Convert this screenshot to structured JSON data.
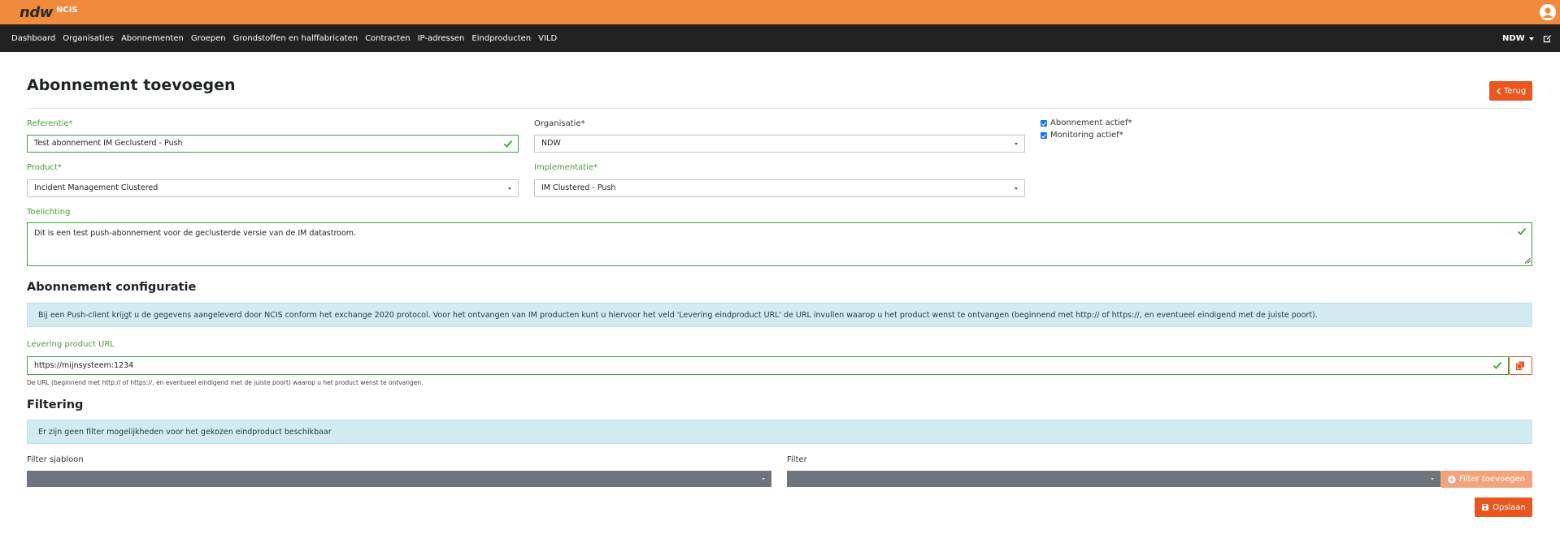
{
  "header": {
    "logo": "ndw",
    "app_name": "NCIS"
  },
  "nav": {
    "items": [
      "Dashboard",
      "Organisaties",
      "Abonnementen",
      "Groepen",
      "Grondstoffen en halffabricaten",
      "Contracten",
      "IP-adressen",
      "Eindproducten",
      "VILD"
    ],
    "org_menu": "NDW"
  },
  "page": {
    "title": "Abonnement toevoegen",
    "back_label": "Terug"
  },
  "form": {
    "referentie": {
      "label": "Referentie*",
      "value": "Test abonnement IM Geclusterd - Push"
    },
    "organisatie": {
      "label": "Organisatie*",
      "value": "NDW"
    },
    "abonnement_actief": {
      "label": "Abonnement actief*",
      "checked": true
    },
    "monitoring_actief": {
      "label": "Monitoring actief*",
      "checked": true
    },
    "product": {
      "label": "Product*",
      "value": "Incident Management Clustered"
    },
    "implementatie": {
      "label": "Implementatie*",
      "value": "IM Clustered - Push"
    },
    "toelichting": {
      "label": "Toelichting",
      "value": "Dit is een test push-abonnement voor de geclusterde versie van de IM datastroom."
    }
  },
  "config": {
    "title": "Abonnement configuratie",
    "info": "Bij een Push-client krijgt u de gegevens aangeleverd door NCIS conform het exchange 2020 protocol. Voor het ontvangen van IM producten kunt u hiervoor het veld 'Levering eindproduct URL' de URL invullen waarop u het product wenst te ontvangen (beginnend met http:// of https://, en eventueel eindigend met de juiste poort).",
    "url_label": "Levering product URL",
    "url_value": "https://mijnsysteem:1234",
    "url_help": "De URL (beginnend met http:// of https://, en eventueel eindigend met de juiste poort) waarop u het product wenst te ontvangen."
  },
  "filtering": {
    "title": "Filtering",
    "info": "Er zijn geen filter mogelijkheden voor het gekozen eindproduct beschikbaar",
    "sjabloon_label": "Filter sjabloon",
    "filter_label": "Filter",
    "add_label": "Filter toevoegen"
  },
  "actions": {
    "save_label": "Opslaan"
  },
  "colors": {
    "brand_orange": "#f28a3c",
    "button_orange": "#e8571f",
    "nav_dark": "#222222",
    "valid_green": "#3aa335",
    "info_bg": "#d1ebf0"
  },
  "icons": [
    "user-avatar-icon",
    "edit-icon",
    "chevron-left-icon",
    "check-icon",
    "copy-icon",
    "plus-circle-icon",
    "save-icon"
  ]
}
